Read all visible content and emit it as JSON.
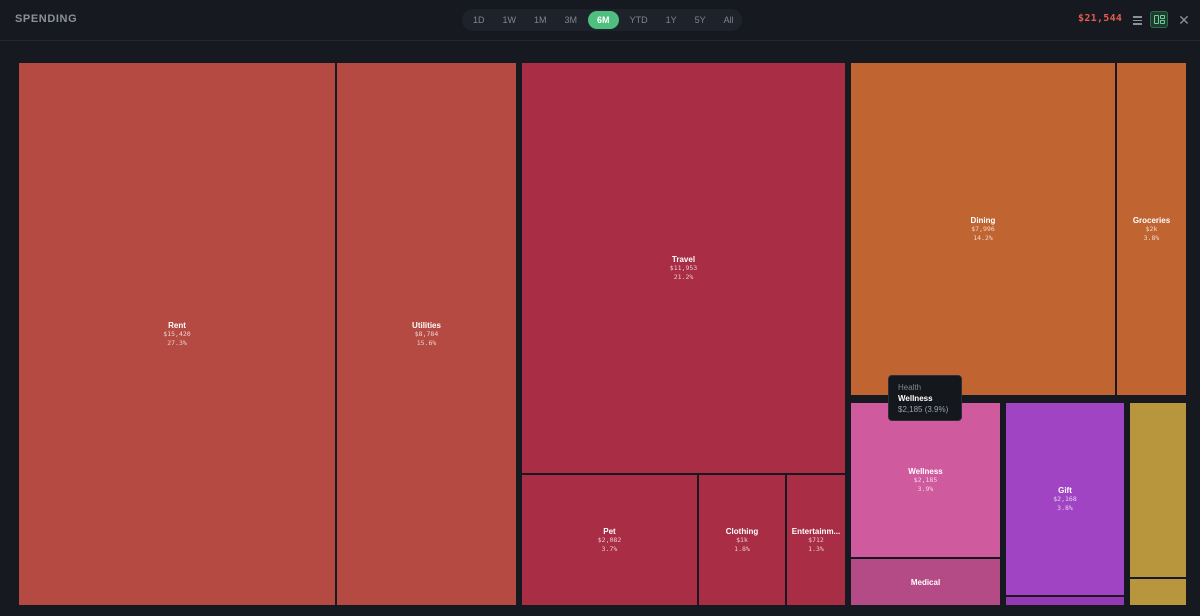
{
  "header": {
    "title": "SPENDING",
    "total": "$21,544",
    "ranges": [
      "1D",
      "1W",
      "1M",
      "3M",
      "6M",
      "YTD",
      "1Y",
      "5Y",
      "All"
    ],
    "active_range": "6M",
    "icons": {
      "list": "list-icon",
      "treemap": "treemap-icon",
      "close": "close-icon"
    }
  },
  "tiles": [
    {
      "name": "Rent",
      "amount": "$15,420",
      "percent": "27.3%",
      "color": "#b54a42"
    },
    {
      "name": "Utilities",
      "amount": "$8,784",
      "percent": "15.6%",
      "color": "#b54a42"
    },
    {
      "name": "Travel",
      "amount": "$11,953",
      "percent": "21.2%",
      "color": "#a82d45"
    },
    {
      "name": "Pet",
      "amount": "$2,082",
      "percent": "3.7%",
      "color": "#a82d45"
    },
    {
      "name": "Clothing",
      "amount": "$1k",
      "percent": "1.8%",
      "color": "#a82d45"
    },
    {
      "name": "Entertainm...",
      "amount": "$712",
      "percent": "1.3%",
      "color": "#a82d45"
    },
    {
      "name": "Dining",
      "amount": "$7,996",
      "percent": "14.2%",
      "color": "#c06532"
    },
    {
      "name": "Groceries",
      "amount": "$2k",
      "percent": "3.8%",
      "color": "#c06532"
    },
    {
      "name": "Wellness",
      "amount": "$2,185",
      "percent": "3.9%",
      "color": "#d05a9e"
    },
    {
      "name": "Medical",
      "amount": "",
      "percent": "",
      "color": "#b44a86"
    },
    {
      "name": "Gift",
      "amount": "$2,168",
      "percent": "3.8%",
      "color": "#a044c4"
    },
    {
      "name": "",
      "amount": "",
      "percent": "",
      "color": "#9538b4"
    },
    {
      "name": "",
      "amount": "",
      "percent": "",
      "color": "#b8963e"
    },
    {
      "name": "",
      "amount": "",
      "percent": "",
      "color": "#b8963e"
    }
  ],
  "tooltip": {
    "group": "Health",
    "name": "Wellness",
    "value": "$2,185 (3.9%)"
  }
}
